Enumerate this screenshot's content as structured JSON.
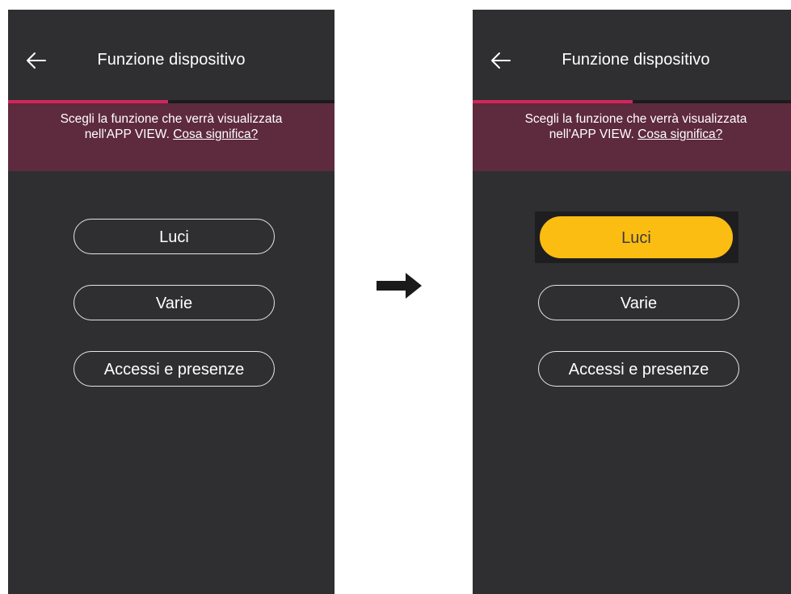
{
  "screens": [
    {
      "header": {
        "title": "Funzione dispositivo"
      },
      "progress": {
        "fraction": 0.49
      },
      "banner": {
        "text_line1": "Scegli la funzione che verrà visualizzata",
        "text_line2_prefix": "nell'APP VIEW. ",
        "link": "Cosa significa?"
      },
      "options": [
        {
          "label": "Luci",
          "selected": false
        },
        {
          "label": "Varie",
          "selected": false
        },
        {
          "label": "Accessi e presenze",
          "selected": false
        }
      ]
    },
    {
      "header": {
        "title": "Funzione dispositivo"
      },
      "progress": {
        "fraction": 0.49
      },
      "banner": {
        "text_line1": "Scegli la funzione che verrà visualizzata",
        "text_line2_prefix": "nell'APP VIEW. ",
        "link": "Cosa significa?"
      },
      "options": [
        {
          "label": "Luci",
          "selected": true
        },
        {
          "label": "Varie",
          "selected": false
        },
        {
          "label": "Accessi e presenze",
          "selected": false
        }
      ]
    }
  ],
  "icons": {
    "back": "arrow-left-icon",
    "transition": "arrow-right-icon"
  },
  "colors": {
    "screen_bg": "#2f2f31",
    "accent": "#d2265a",
    "banner_bg": "#5e2a3d",
    "selected_bg": "#fcbd13",
    "transition_arrow": "#1a1a1a"
  }
}
